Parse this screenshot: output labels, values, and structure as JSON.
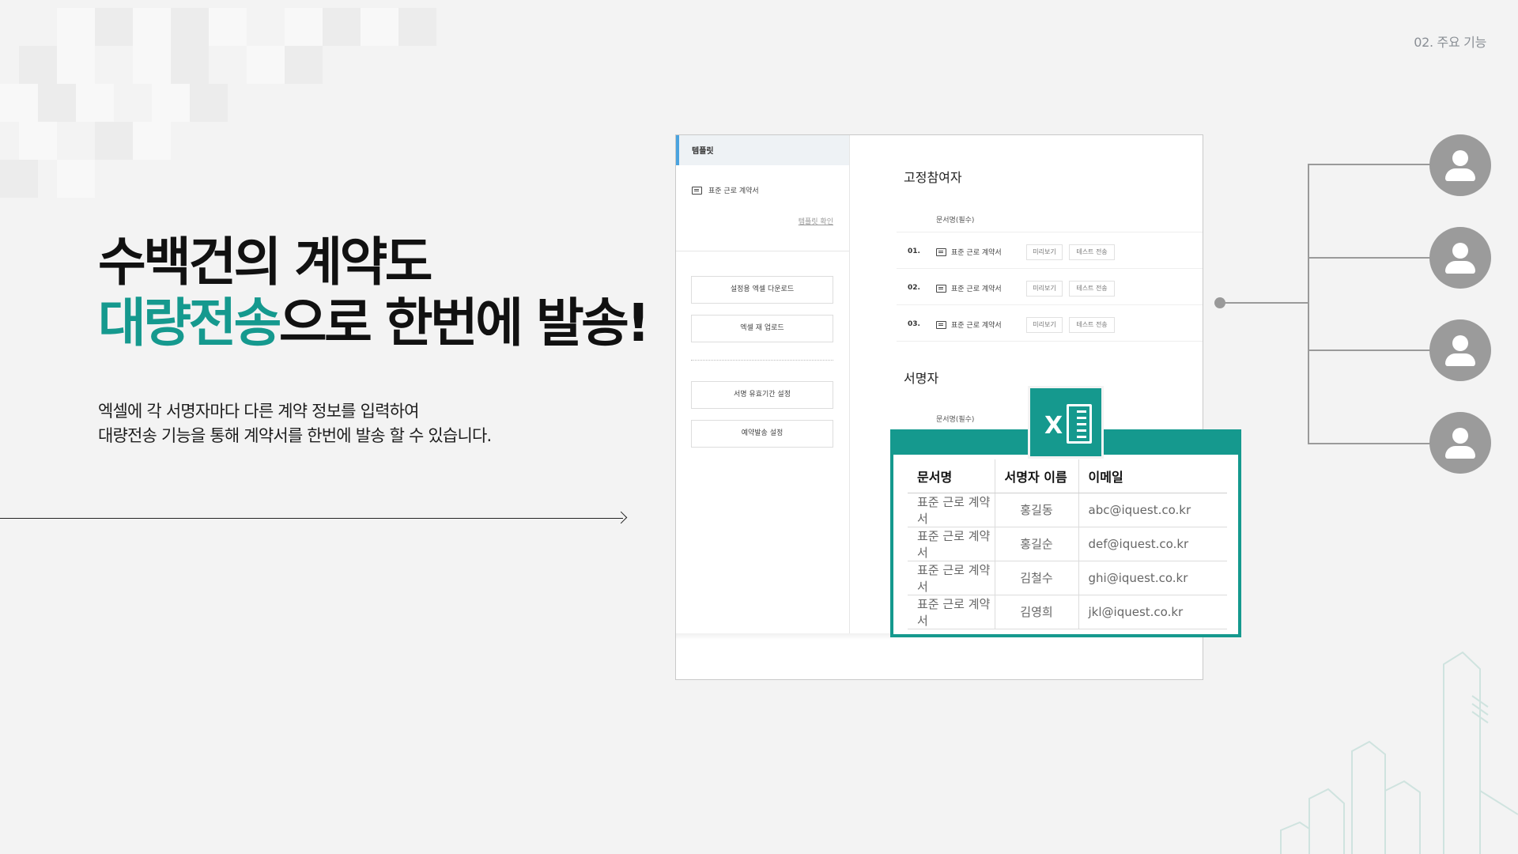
{
  "page_label": "02. 주요 기능",
  "headline": {
    "line1": "수백건의 계약도",
    "line2_accent": "대량전송",
    "line2_rest": "으로 한번에 발송!"
  },
  "description": {
    "line1": "엑셀에 각 서명자마다 다른 계약 정보를 입력하여",
    "line2": "대량전송 기능을 통해 계약서를 한번에 발송 할 수 있습니다."
  },
  "app": {
    "template_header": "템플릿",
    "template_item": "표준 근로 계약서",
    "template_link": "템플릿 확인",
    "side_buttons": [
      "설정용 엑셀 다운로드",
      "엑셀 재 업로드",
      "서명 유효기간 설정",
      "예약발송 설정"
    ],
    "fixed_section": {
      "title": "고정참여자",
      "header": "문서명(필수)",
      "rows": [
        {
          "num": "01.",
          "doc": "표준 근로 계약서",
          "preview": "미리보기",
          "test": "테스트 전송"
        },
        {
          "num": "02.",
          "doc": "표준 근로 계약서",
          "preview": "미리보기",
          "test": "테스트 전송"
        },
        {
          "num": "03.",
          "doc": "표준 근로 계약서",
          "preview": "미리보기",
          "test": "테스트 전송"
        }
      ]
    },
    "signer_section": {
      "title": "서명자",
      "header": "문서명(필수)"
    }
  },
  "excel_table": {
    "headers": [
      "문서명",
      "서명자 이름",
      "이메일"
    ],
    "rows": [
      [
        "표준 근로 계약서",
        "홍길동",
        "abc@iquest.co.kr"
      ],
      [
        "표준 근로 계약서",
        "홍길순",
        "def@iquest.co.kr"
      ],
      [
        "표준 근로 계약서",
        "김철수",
        "ghi@iquest.co.kr"
      ],
      [
        "표준 근로 계약서",
        "김영희",
        "jkl@iquest.co.kr"
      ]
    ]
  },
  "icons": {
    "excel": "excel-icon",
    "avatar": "user-avatar-icon",
    "doc": "document-icon"
  },
  "colors": {
    "accent": "#15998e",
    "selection": "#4aa3df"
  }
}
